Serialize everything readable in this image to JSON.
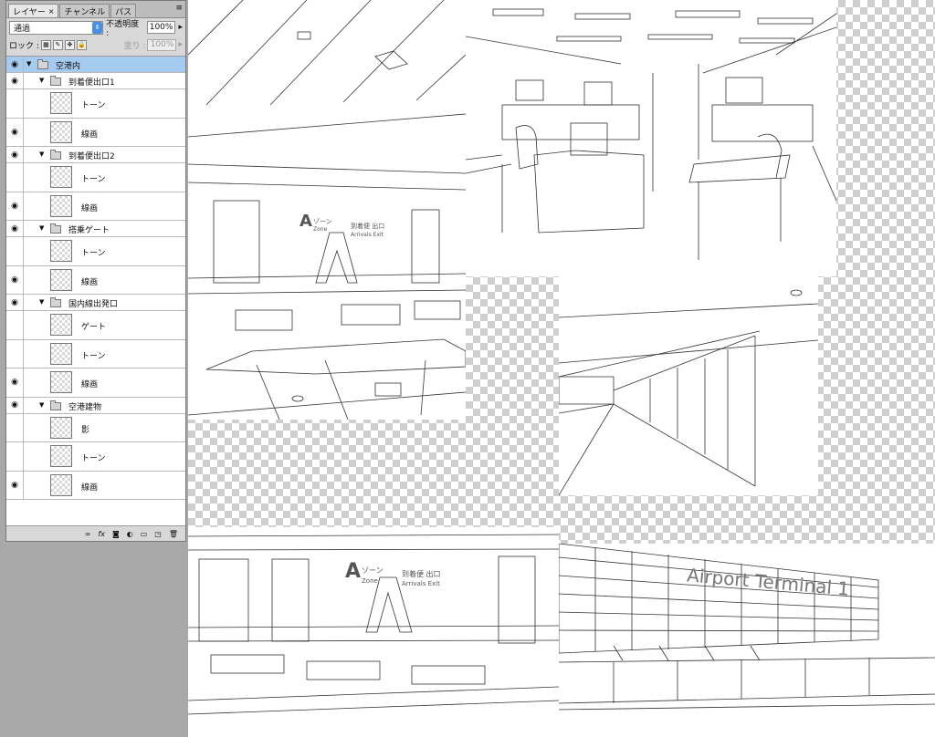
{
  "layers_panel": {
    "tabs": [
      {
        "label": "レイヤー",
        "close": "×"
      },
      {
        "label": "チャンネル"
      },
      {
        "label": "パス"
      }
    ],
    "menu_icon": "≡",
    "blend_mode": "通過",
    "opacity_label": "不透明度 :",
    "opacity_value": "100%",
    "lock_label": "ロック :",
    "fill_label": "塗り :",
    "fill_value": "100%",
    "layers": [
      {
        "name": "空港内",
        "type": "group",
        "visible": true,
        "selected": true,
        "indent": 0
      },
      {
        "name": "到着便出口1",
        "type": "group",
        "visible": true,
        "indent": 1
      },
      {
        "name": "トーン",
        "type": "layer",
        "visible": false,
        "indent": 2
      },
      {
        "name": "線画",
        "type": "layer",
        "visible": true,
        "indent": 2
      },
      {
        "name": "到着便出口2",
        "type": "group",
        "visible": true,
        "indent": 1
      },
      {
        "name": "トーン",
        "type": "layer",
        "visible": false,
        "indent": 2
      },
      {
        "name": "線画",
        "type": "layer",
        "visible": true,
        "indent": 2
      },
      {
        "name": "搭乗ゲート",
        "type": "group",
        "visible": true,
        "indent": 1
      },
      {
        "name": "トーン",
        "type": "layer",
        "visible": false,
        "indent": 2
      },
      {
        "name": "線画",
        "type": "layer",
        "visible": true,
        "indent": 2
      },
      {
        "name": "国内線出発口",
        "type": "group",
        "visible": true,
        "indent": 1
      },
      {
        "name": "ゲート",
        "type": "layer",
        "visible": false,
        "indent": 2
      },
      {
        "name": "トーン",
        "type": "layer",
        "visible": false,
        "indent": 2
      },
      {
        "name": "線画",
        "type": "layer",
        "visible": true,
        "indent": 2
      },
      {
        "name": "空港建物",
        "type": "group",
        "visible": true,
        "indent": 1
      },
      {
        "name": "影",
        "type": "layer",
        "visible": false,
        "indent": 2
      },
      {
        "name": "トーン",
        "type": "layer",
        "visible": false,
        "indent": 2
      },
      {
        "name": "線画",
        "type": "layer",
        "visible": true,
        "indent": 2
      }
    ],
    "bottom_icons": [
      "link-icon",
      "fx-icon",
      "mask-icon",
      "adjustment-icon",
      "new-group-icon",
      "new-layer-icon",
      "trash-icon"
    ]
  },
  "canvas": {
    "signs": {
      "zone_letter": "A",
      "zone_kana": "ゾーン",
      "zone_label": "Zone",
      "exit_jp": "到着便 出口",
      "exit_en": "Arrivals Exit",
      "terminal_name": "Airport Terminal 1"
    }
  }
}
